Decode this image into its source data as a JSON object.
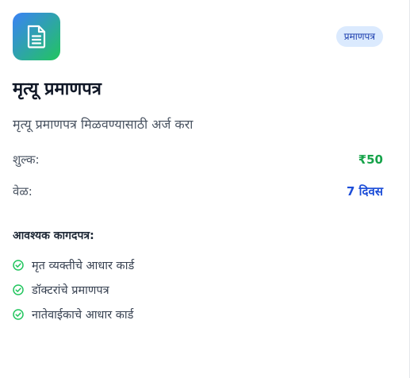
{
  "card": {
    "icon": "document-text-icon",
    "badge": "प्रमाणपत्र",
    "title": "मृत्यू प्रमाणपत्र",
    "description": "मृत्यू प्रमाणपत्र मिळवण्यासाठी अर्ज करा",
    "fee": {
      "label": "शुल्क:",
      "value": "₹50"
    },
    "time": {
      "label": "वेळ:",
      "value": "7 दिवस"
    },
    "documents": {
      "heading": "आवश्यक कागदपत्र:",
      "items": [
        "मृत व्यक्तीचे आधार कार्ड",
        "डॉक्टरांचे प्रमाणपत्र",
        "नातेवाईकाचे आधार कार्ड"
      ]
    }
  },
  "colors": {
    "gradient_start": "#3b82f6",
    "gradient_end": "#22c55e",
    "badge_bg": "#dbeafe",
    "badge_text": "#1e40af",
    "fee_value": "#16a34a",
    "time_value": "#1d4ed8",
    "check": "#22c55e"
  }
}
